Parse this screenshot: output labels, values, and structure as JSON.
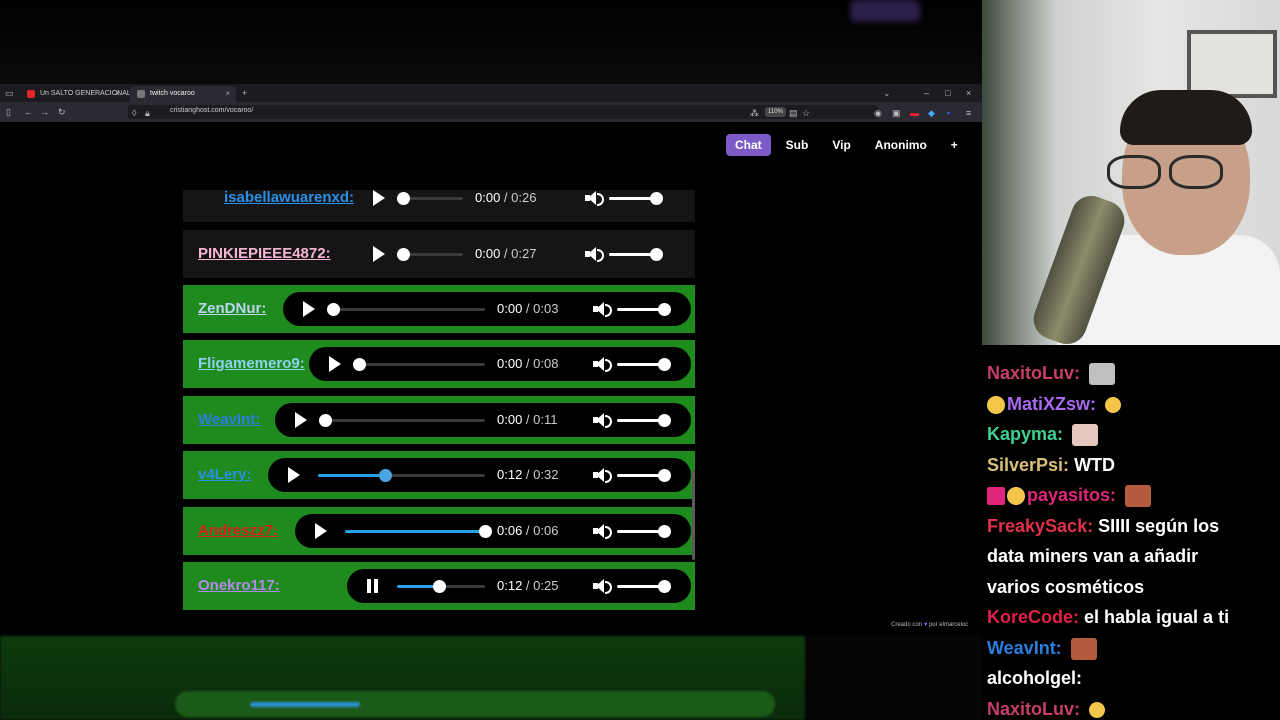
{
  "browser": {
    "tabs": [
      {
        "label": "Un SALTO GENERACIONAL IMF"
      },
      {
        "label": "twitch vocaroo"
      }
    ],
    "new_tab": "+",
    "url": "cristianghost.com/vocaroo/",
    "zoom": "110%"
  },
  "nav": {
    "buttons": [
      "Chat",
      "Sub",
      "Vip",
      "Anonimo",
      "+"
    ],
    "active": "Chat"
  },
  "credit": {
    "prefix": "Creado con",
    "suffix": "por elmarceloc"
  },
  "rows": [
    {
      "user": "isabellawuarenxd:",
      "color": "#2a8fe6",
      "bg": "dark",
      "current": "0:00",
      "duration": "0:26",
      "progress": 0.0,
      "playing": false
    },
    {
      "user": "PINKIEPIEEE4872:",
      "color": "#f6b6d4",
      "bg": "dark",
      "current": "0:00",
      "duration": "0:27",
      "progress": 0.0,
      "playing": false
    },
    {
      "user": "ZenDNur:",
      "color": "#bcd6f2",
      "bg": "green",
      "current": "0:00",
      "duration": "0:03",
      "progress": 0.0,
      "playing": false
    },
    {
      "user": "Fligamemero9:",
      "color": "#8fd2f0",
      "bg": "green",
      "current": "0:00",
      "duration": "0:08",
      "progress": 0.0,
      "playing": false
    },
    {
      "user": "WeavInt:",
      "color": "#2a7fe0",
      "bg": "green",
      "current": "0:00",
      "duration": "0:11",
      "progress": 0.0,
      "playing": false
    },
    {
      "user": "v4Lery:",
      "color": "#2a8fe6",
      "bg": "green",
      "current": "0:12",
      "duration": "0:32",
      "progress": 0.4,
      "playing": false
    },
    {
      "user": "Andreszz7:",
      "color": "#d81f1f",
      "bg": "green",
      "current": "0:06",
      "duration": "0:06",
      "progress": 1.0,
      "playing": false
    },
    {
      "user": "Onekro117:",
      "color": "#b58af0",
      "bg": "green",
      "current": "0:12",
      "duration": "0:25",
      "progress": 0.48,
      "playing": true
    }
  ],
  "chat": [
    {
      "user": "NaxitoLuv:",
      "color": "#c43d6e",
      "text": "",
      "emote": "gray"
    },
    {
      "user": "MatiXZsw:",
      "color": "#a869f0",
      "text": "",
      "emote": "yellow-small",
      "pre": "yellow"
    },
    {
      "user": "Kapyma:",
      "color": "#3fcf8e",
      "text": "",
      "emote": "gray2"
    },
    {
      "user": "SilverPsi:",
      "color": "#d8c07a",
      "text": "WTD",
      "emote": ""
    },
    {
      "user": "payasitos:",
      "color": "#e0257a",
      "text": "",
      "emote": "face",
      "pre": "badges"
    },
    {
      "user": "FreakySack:",
      "color": "#e0304a",
      "text": "SIIII según los",
      "emote": ""
    },
    {
      "user": "",
      "color": "#fff",
      "text": "data miners van a añadir",
      "emote": ""
    },
    {
      "user": "",
      "color": "#fff",
      "text": "varios cosméticos",
      "emote": ""
    },
    {
      "user": "KoreCode:",
      "color": "#e0204a",
      "text": "el habla igual a ti",
      "emote": ""
    },
    {
      "user": "WeavInt:",
      "color": "#2a7fe0",
      "text": "",
      "emote": "face"
    },
    {
      "user": "alcoholgel:",
      "color": "#ffffff",
      "text": "",
      "emote": ""
    },
    {
      "user": "NaxitoLuv:",
      "color": "#c43d6e",
      "text": "",
      "emote": "yellow-small"
    }
  ]
}
